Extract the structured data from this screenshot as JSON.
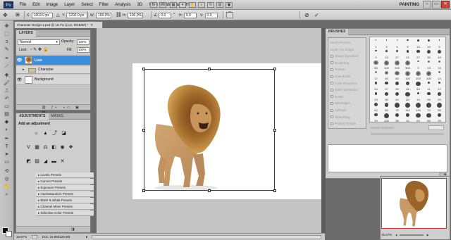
{
  "menubar": {
    "logo": "Ps",
    "items": [
      "File",
      "Edit",
      "Image",
      "Layer",
      "Select",
      "Filter",
      "Analysis",
      "3D",
      "View",
      "Window",
      "Help"
    ],
    "workspace": "PAINTING",
    "window_buttons": [
      "–",
      "▭",
      "✕"
    ]
  },
  "options": {
    "x_label": "X:",
    "x_value": "1603.0 px",
    "y_label": "Y:",
    "y_value": "1292.0 px",
    "w_label": "W:",
    "w_value": "100.0%",
    "h_label": "H:",
    "h_value": "100.0%",
    "angle_value": "0.0",
    "hskew_label": "H:",
    "hskew_value": "0.0",
    "vskew_label": "V:",
    "vskew_value": "0.0"
  },
  "document": {
    "tab_title": "Character Design 1.psd @ 16.7% (Lion, RGB/8#) *"
  },
  "layers_panel": {
    "tab": "LAYERS",
    "blend_mode": "Normal",
    "opacity_label": "Opacity:",
    "opacity_value": "100%",
    "lock_label": "Lock:",
    "fill_label": "Fill:",
    "fill_value": "100%",
    "layers": [
      {
        "name": "Lion",
        "selected": true,
        "visible": true
      },
      {
        "name": "Character",
        "selected": false,
        "visible": false
      },
      {
        "name": "Background",
        "selected": false,
        "visible": true
      }
    ]
  },
  "adjustments_panel": {
    "tabs": [
      "ADJUSTMENTS",
      "MASKS"
    ],
    "heading": "Add an adjustment",
    "presets": [
      "Levels Presets",
      "Curves Presets",
      "Exposure Presets",
      "Hue/Saturation Presets",
      "Black & White Presets",
      "Channel Mixer Presets",
      "Selective Color Presets"
    ]
  },
  "brushes_panel": {
    "tab": "BRUSHES",
    "options": [
      "Brush Presets",
      "Brush Tip Shape",
      "Shape Dynamics",
      "Scattering",
      "Texture",
      "Dual Brush",
      "Color Dynamics",
      "Other Dynamics",
      "Noise",
      "Wet Edges",
      "Airbrush",
      "Smoothing",
      "Protect Texture"
    ],
    "brush_sizes": [
      "1",
      "3",
      "5",
      "9",
      "13",
      "19",
      "5",
      "9",
      "13",
      "17",
      "21",
      "27",
      "35",
      "45",
      "65",
      "100",
      "200",
      "300",
      "9",
      "13",
      "19",
      "17",
      "45",
      "65",
      "100",
      "200",
      "300",
      "14",
      "24",
      "27",
      "39",
      "46",
      "59",
      "11",
      "17",
      "23",
      "36",
      "44",
      "60",
      "14",
      "26",
      "33",
      "42",
      "55",
      "70",
      "112",
      "134",
      "74",
      "95",
      "29",
      "192",
      "36",
      "33",
      "63",
      "66",
      "39",
      "63",
      "11",
      "48",
      "32",
      "55",
      "100",
      "75",
      "45"
    ],
    "diameter_label": "Master Diameter"
  },
  "status": {
    "zoom": "16.67%",
    "doc_info": "Doc: 24.9M/126.9M"
  },
  "navigator": {
    "zoom": "16.67%"
  }
}
